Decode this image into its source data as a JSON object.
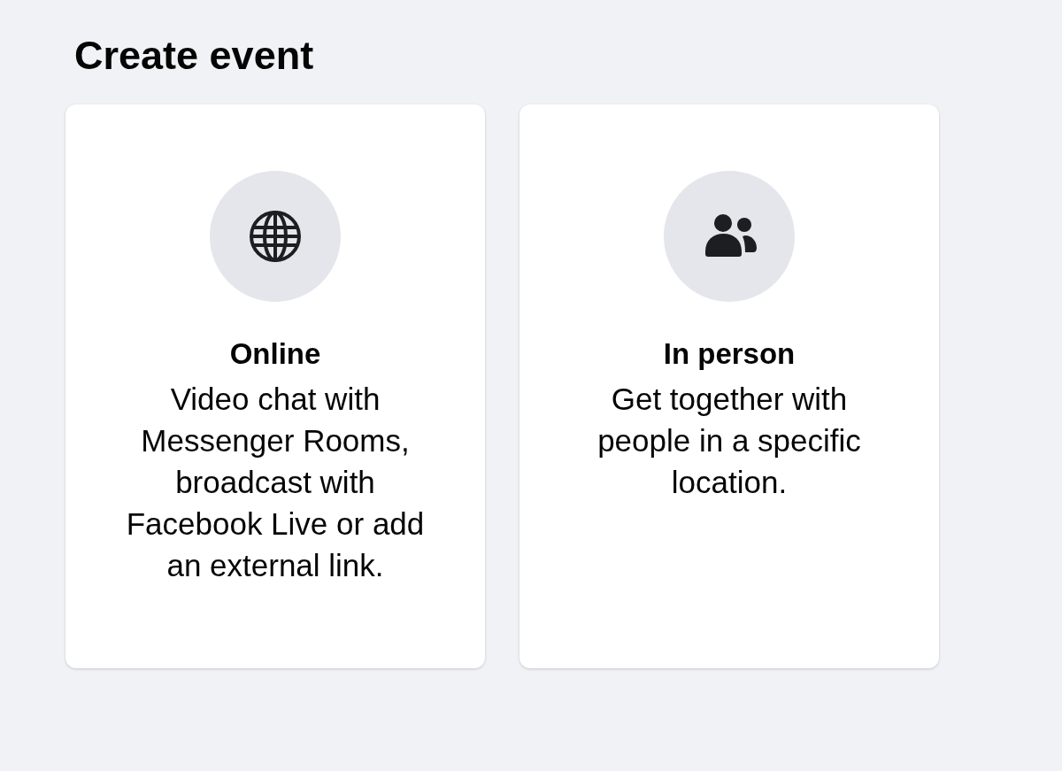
{
  "page_title": "Create event",
  "options": [
    {
      "kind": "online",
      "title": "Online",
      "description": "Video chat with Messenger Rooms, broadcast with Facebook Live or add an external link."
    },
    {
      "kind": "in_person",
      "title": "In person",
      "description": "Get together with people in a specific location."
    }
  ]
}
